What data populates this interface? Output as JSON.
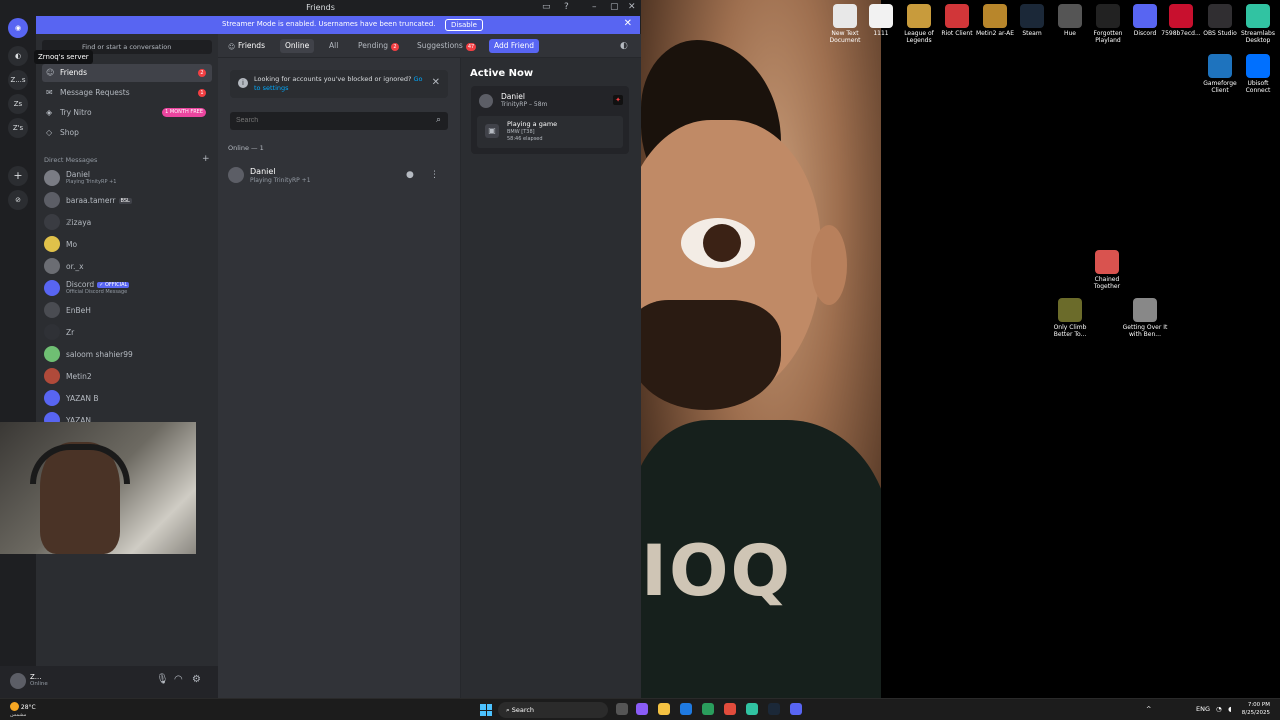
{
  "window": {
    "title": "Friends",
    "banner_text": "Streamer Mode is enabled. Usernames have been truncated.",
    "banner_button": "Disable"
  },
  "guilds": {
    "tooltip": "Zrnoq's server",
    "items": [
      "Z...s",
      "Zs",
      "Z's"
    ]
  },
  "sidebar": {
    "search_placeholder": "Find or start a conversation",
    "nav": [
      {
        "label": "Friends",
        "badge": "2"
      },
      {
        "label": "Message Requests",
        "badge": "1"
      },
      {
        "label": "Try Nitro",
        "pill": "1 MONTH FREE"
      },
      {
        "label": "Shop"
      }
    ],
    "dm_header": "Direct Messages",
    "dms": [
      {
        "name": "Daniel",
        "sub": "Playing TrinityRP +1"
      },
      {
        "name": "baraa.tamerr",
        "tag": "BSL"
      },
      {
        "name": "ℤizaya"
      },
      {
        "name": "Mo"
      },
      {
        "name": "or._x"
      },
      {
        "name": "Discord",
        "tag": "✓ OFFICIAL",
        "sub": "Official Discord Message"
      },
      {
        "name": "EnBeH"
      },
      {
        "name": "Zr"
      },
      {
        "name": "saloom shahier99"
      },
      {
        "name": "Metin2"
      },
      {
        "name": "YAZAN B"
      },
      {
        "name": "YAZAN"
      }
    ]
  },
  "user": {
    "name": "Z...",
    "status": "Online"
  },
  "topbar": {
    "title": "Friends",
    "tabs": [
      "Online",
      "All",
      "Pending",
      "Suggestions"
    ],
    "pending_badge": "2",
    "suggestions_badge": "47",
    "add_friend": "Add Friend"
  },
  "main": {
    "notice_text": "Looking for accounts you've blocked or ignored?",
    "notice_link": "Go to settings",
    "search_placeholder": "Search",
    "online_count": "Online — 1",
    "friend": {
      "name": "Daniel",
      "sub": "Playing TrinityRP +1"
    }
  },
  "active_now": {
    "title": "Active Now",
    "name": "Daniel",
    "sub": "TrinityRP – 58m",
    "playing": "Playing a game",
    "detail1": "BMW [T38]",
    "detail2": "58:46 elapsed"
  },
  "desktop_icons": [
    {
      "label": "New Text Document",
      "color": "#e8e8e8"
    },
    {
      "label": "1111",
      "color": "#f2f2f2"
    },
    {
      "label": "League of Legends",
      "color": "#c89b3c"
    },
    {
      "label": "Riot Client",
      "color": "#d13639"
    },
    {
      "label": "Metin2 ar-AE",
      "color": "#b8862b"
    },
    {
      "label": "Steam",
      "color": "#1b2838"
    },
    {
      "label": "Hue",
      "color": "#555555"
    },
    {
      "label": "Forgotten Playland",
      "color": "#222222"
    },
    {
      "label": "Discord",
      "color": "#5865f2"
    },
    {
      "label": "7598b7ecd...",
      "color": "#c8102e"
    },
    {
      "label": "OBS Studio",
      "color": "#302e31"
    },
    {
      "label": "Streamlabs Desktop",
      "color": "#31c3a2"
    },
    {
      "label": "Gameforge Client",
      "color": "#1e73be"
    },
    {
      "label": "Ubisoft Connect",
      "color": "#0070ff"
    },
    {
      "label": "Chained Together",
      "color": "#d9534f"
    },
    {
      "label": "Only Climb Better To...",
      "color": "#6b6b2a"
    },
    {
      "label": "Getting Over It with Ben...",
      "color": "#888888"
    }
  ],
  "wallpaper_text": "IOQ",
  "taskbar": {
    "temp": "28°C",
    "weather_sub": "مشمس",
    "search": "Search",
    "lang": "ENG",
    "time": "7:00 PM",
    "date": "8/25/2025"
  }
}
